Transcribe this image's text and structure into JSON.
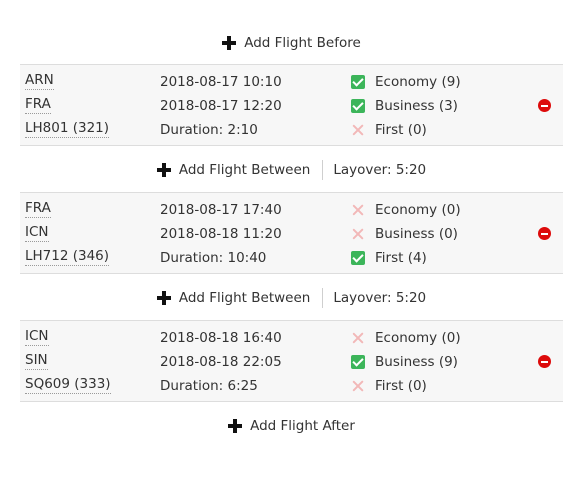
{
  "actions": {
    "add_before": "Add Flight Before",
    "add_between": "Add Flight Between",
    "add_after": "Add Flight After"
  },
  "layovers": [
    "Layover: 5:20",
    "Layover: 5:20"
  ],
  "flights": [
    {
      "from": "ARN",
      "to": "FRA",
      "flight": "LH801 (321)",
      "depart": "2018-08-17 10:10",
      "arrive": "2018-08-17 12:20",
      "duration": "Duration: 2:10",
      "classes": [
        {
          "label": "Economy (9)",
          "available": true
        },
        {
          "label": "Business (3)",
          "available": true
        },
        {
          "label": "First (0)",
          "available": false
        }
      ]
    },
    {
      "from": "FRA",
      "to": "ICN",
      "flight": "LH712 (346)",
      "depart": "2018-08-17 17:40",
      "arrive": "2018-08-18 11:20",
      "duration": "Duration: 10:40",
      "classes": [
        {
          "label": "Economy (0)",
          "available": false
        },
        {
          "label": "Business (0)",
          "available": false
        },
        {
          "label": "First (4)",
          "available": true
        }
      ]
    },
    {
      "from": "ICN",
      "to": "SIN",
      "flight": "SQ609 (333)",
      "depart": "2018-08-18 16:40",
      "arrive": "2018-08-18 22:05",
      "duration": "Duration: 6:25",
      "classes": [
        {
          "label": "Economy (0)",
          "available": false
        },
        {
          "label": "Business (9)",
          "available": true
        },
        {
          "label": "First (0)",
          "available": false
        }
      ]
    }
  ],
  "icons": {
    "add": "plus-icon",
    "available": "check-icon",
    "unavailable": "cross-icon",
    "remove": "remove-icon"
  },
  "colors": {
    "available": "#3cb55a",
    "unavailable": "#f2b8b8",
    "remove": "#dd0b0b",
    "text": "#333333",
    "row_bg": "#f7f7f7"
  }
}
